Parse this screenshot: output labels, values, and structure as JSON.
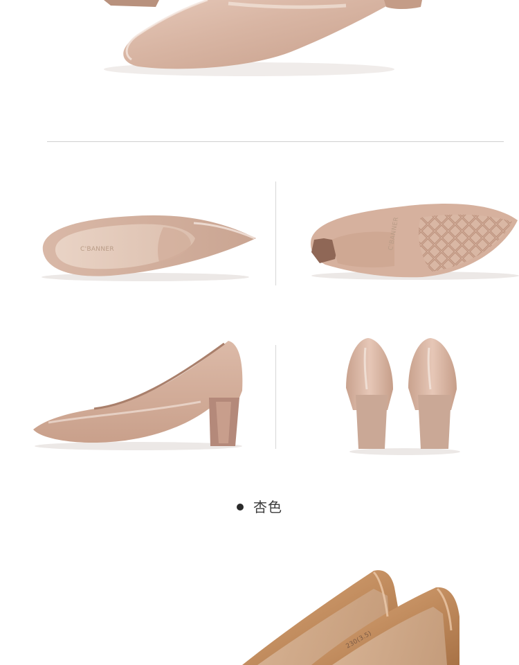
{
  "product": {
    "brand_on_insole": "C'BANNER",
    "sole_marking": "230(3.5)",
    "color_label": "杏色",
    "colors": {
      "nude_patent": "#d6b3a2",
      "nude_dark": "#b78f7b",
      "caramel_patent": "#c79264",
      "divider": "#cfcfcf"
    }
  },
  "sections": [
    {
      "name": "top-partial-shoe"
    },
    {
      "name": "four-angle-grid"
    },
    {
      "name": "color-variant"
    },
    {
      "name": "bottom-partial-shoe"
    }
  ]
}
